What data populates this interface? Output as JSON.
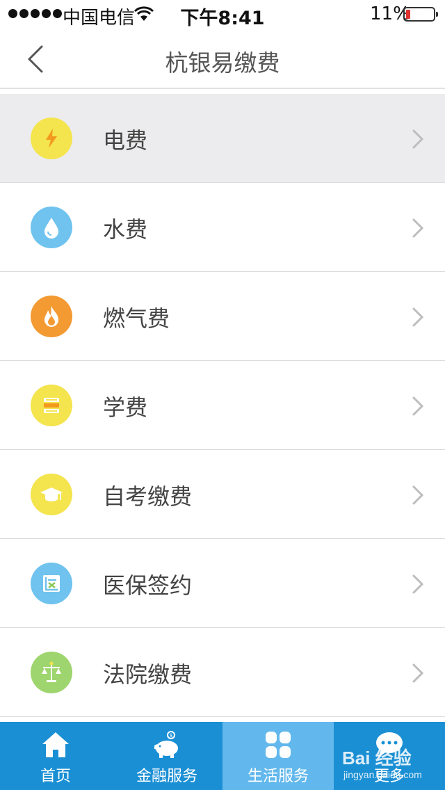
{
  "status_bar": {
    "carrier": "中国电信",
    "time": "下午8:41",
    "battery": "11%"
  },
  "nav": {
    "title": "杭银易缴费"
  },
  "items": [
    {
      "label": "电费",
      "icon": "lightning-icon",
      "color": "#f4e44e"
    },
    {
      "label": "水费",
      "icon": "water-drop-icon",
      "color": "#6fc3ee"
    },
    {
      "label": "燃气费",
      "icon": "flame-icon",
      "color": "#f39a33"
    },
    {
      "label": "学费",
      "icon": "book-stack-icon",
      "color": "#f4e44e"
    },
    {
      "label": "自考缴费",
      "icon": "graduation-cap-icon",
      "color": "#f4e44e"
    },
    {
      "label": "医保签约",
      "icon": "medical-card-icon",
      "color": "#6fc3ee"
    },
    {
      "label": "法院缴费",
      "icon": "scales-icon",
      "color": "#9ed56e"
    }
  ],
  "tabs": [
    {
      "label": "首页",
      "icon": "home-icon"
    },
    {
      "label": "金融服务",
      "icon": "piggy-bank-icon"
    },
    {
      "label": "生活服务",
      "icon": "grid-icon"
    },
    {
      "label": "更多",
      "icon": "chat-bubble-icon"
    }
  ],
  "watermark": {
    "text": "Bai 经验",
    "sub": "jingyan.baidu.com"
  },
  "colors": {
    "tab_bar": "#1a8fd4",
    "tab_active": "#62b8ec",
    "row_active": "#ececee"
  }
}
